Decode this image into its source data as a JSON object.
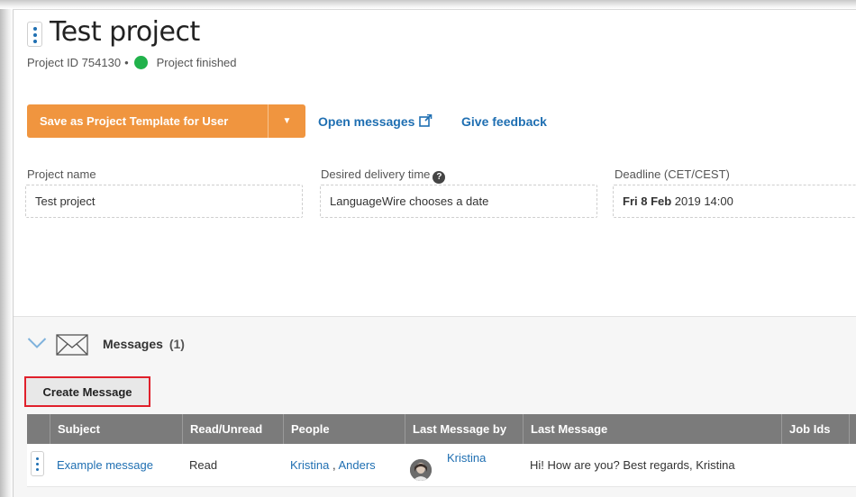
{
  "header": {
    "title": "Test project",
    "project_id_text": "Project ID 754130",
    "separator": "•",
    "status_text": "Project finished",
    "status_color": "#21b24b"
  },
  "toolbar": {
    "save_template_label": "Save as Project Template for User",
    "open_messages_label": "Open messages",
    "give_feedback_label": "Give feedback",
    "accent_color": "#f0953f"
  },
  "fields": {
    "project_name_label": "Project name",
    "project_name_value": "Test project",
    "delivery_label": "Desired delivery time",
    "delivery_value": "LanguageWire chooses a date",
    "deadline_label": "Deadline (CET/CEST)",
    "deadline_day": "Fri 8 Feb",
    "deadline_rest": " 2019 14:00"
  },
  "messages": {
    "title": "Messages",
    "count": "(1)",
    "create_label": "Create Message",
    "columns": [
      "Subject",
      "Read/Unread",
      "People",
      "Last Message by",
      "Last Message",
      "Job Ids"
    ],
    "rows": [
      {
        "subject": "Example message",
        "read_state": "Read",
        "person_1": "Kristina",
        "people_sep": " , ",
        "person_2": "Anders",
        "last_by": "Kristina",
        "last_message": "Hi! How are you? Best regards, Kristina",
        "job_ids": ""
      }
    ]
  }
}
